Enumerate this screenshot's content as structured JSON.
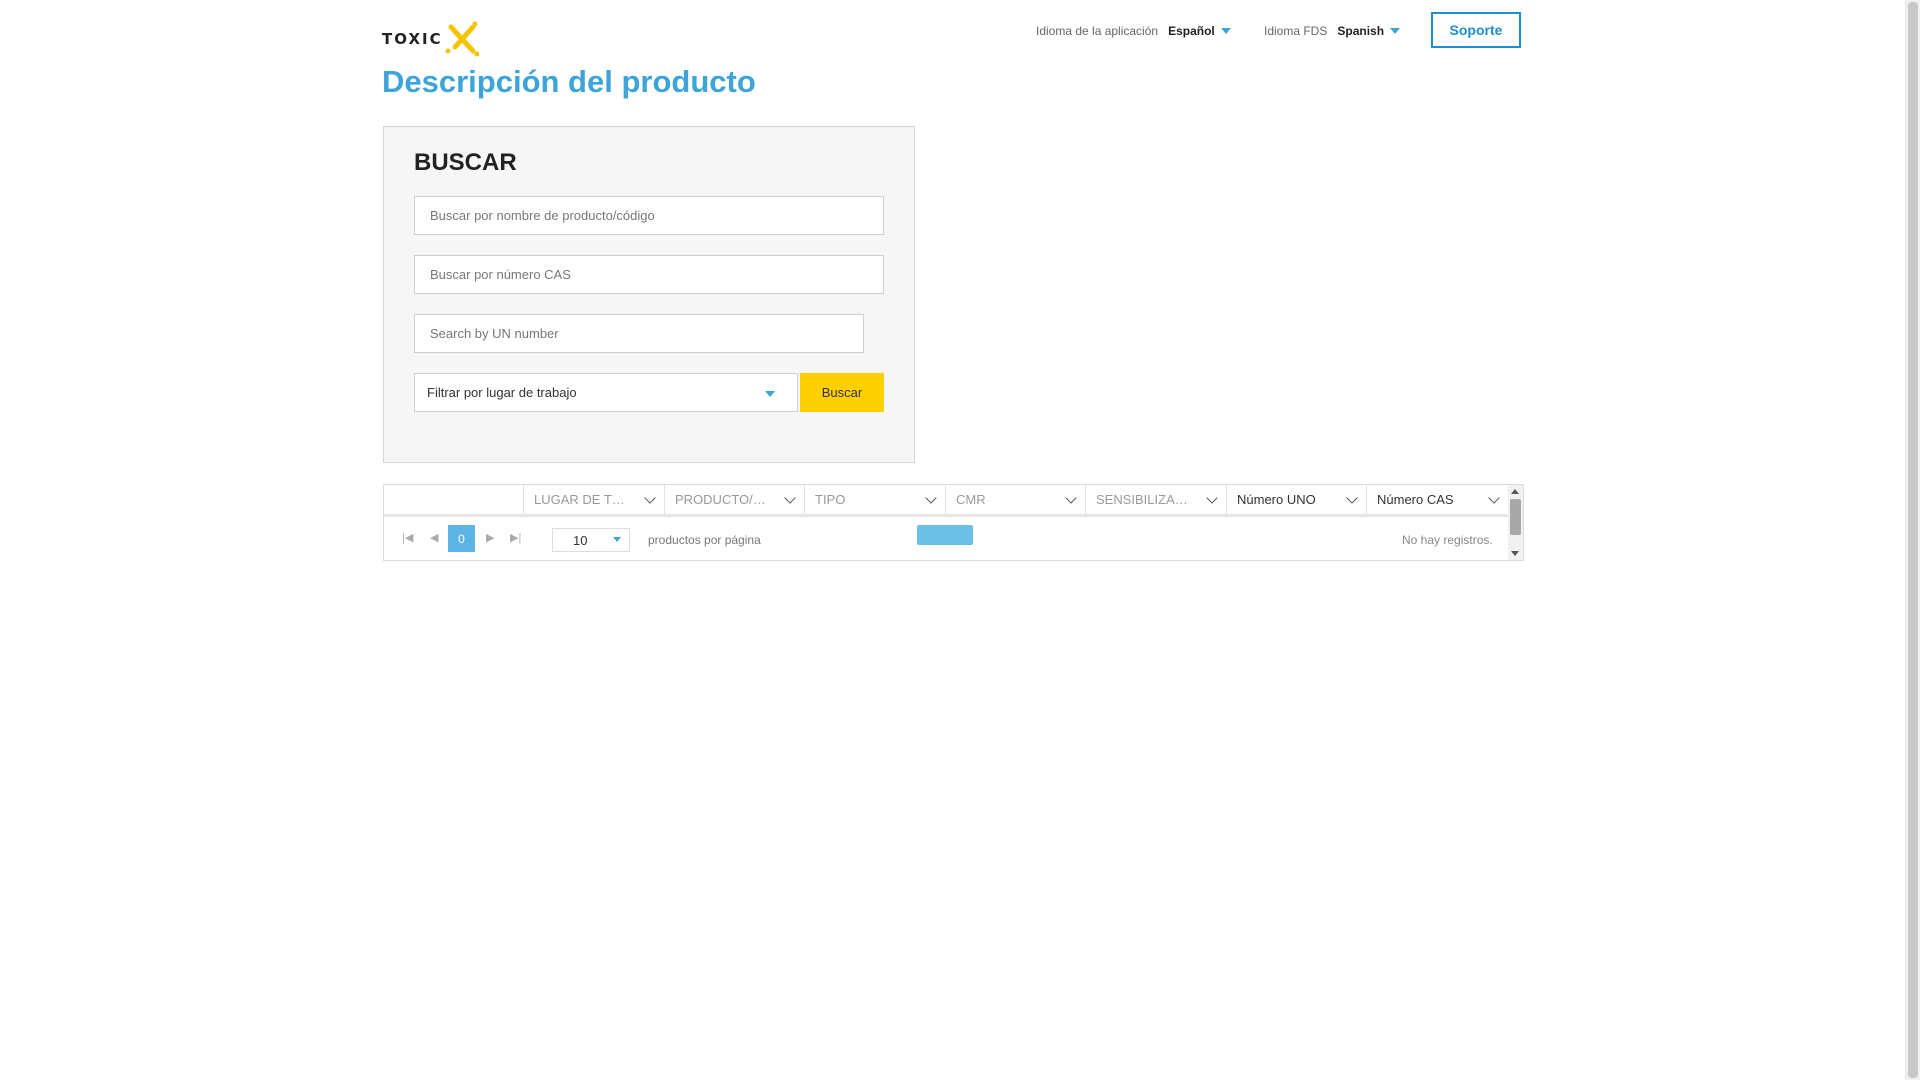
{
  "header": {
    "logo_text": "TOXIC",
    "app_language_label": "Idioma de la aplicación",
    "app_language_value": "Español",
    "sds_language_label": "Idioma FDS",
    "sds_language_value": "Spanish",
    "support_label": "Soporte"
  },
  "page_title": "Descripción del producto",
  "search": {
    "heading": "BUSCAR",
    "product_placeholder": "Buscar por nombre de producto/código",
    "cas_placeholder": "Buscar por número CAS",
    "un_placeholder": "Search by UN number",
    "workplace_filter": "Filtrar por lugar de trabajo",
    "search_button": "Buscar"
  },
  "grid": {
    "columns": [
      {
        "label": "",
        "filter": false
      },
      {
        "label": "LUGAR DE TRABAJO",
        "filter": true
      },
      {
        "label": "PRODUCTO/NOMBRE",
        "filter": true
      },
      {
        "label": "TIPO",
        "filter": true
      },
      {
        "label": "CMR",
        "filter": true
      },
      {
        "label": "SENSIBILIZANTE",
        "filter": true
      },
      {
        "label": "Número UNO",
        "filter": true
      },
      {
        "label": "Número CAS",
        "filter": true
      }
    ],
    "pager": {
      "current_page": "0",
      "page_size": "10",
      "page_size_label": "productos por página",
      "empty_message": "No hay registros."
    }
  },
  "colors": {
    "accent": "#3da4d9",
    "support_border": "#1e8ed0",
    "search_button": "#ffd000",
    "logo_yellow": "#f5c400"
  }
}
